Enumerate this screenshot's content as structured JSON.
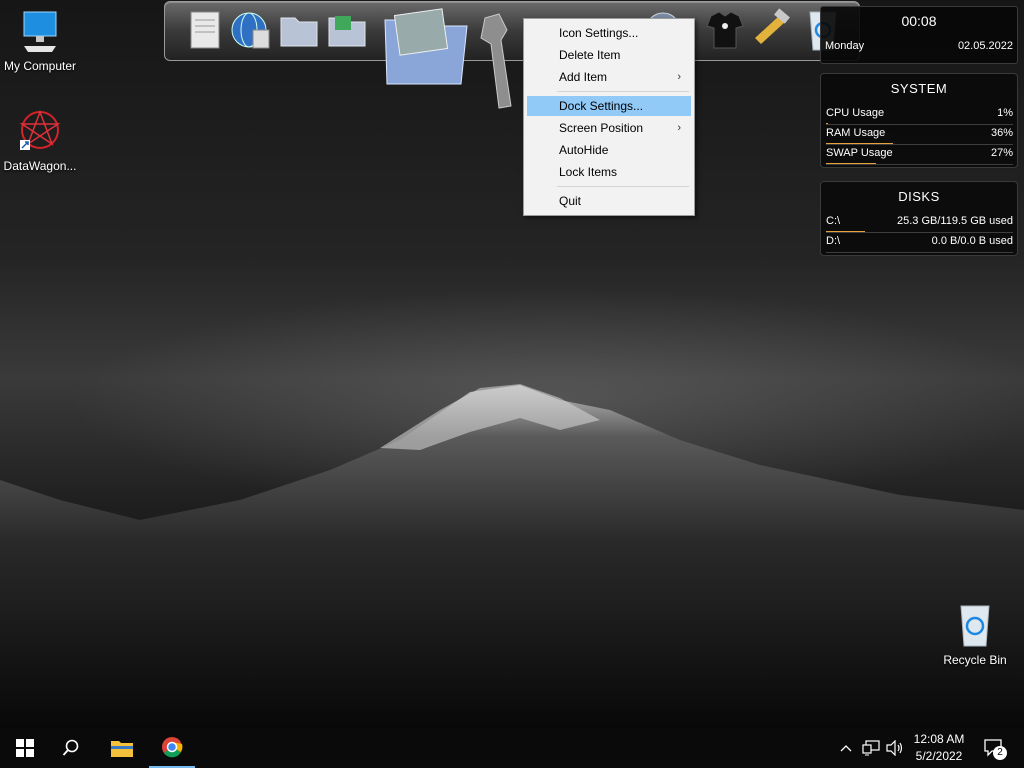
{
  "desktop": {
    "icons": [
      {
        "label": "My Computer",
        "icon": "monitor-icon"
      },
      {
        "label": "DataWagon...",
        "icon": "datawagon-shortcut-icon"
      },
      {
        "label": "Recycle Bin",
        "icon": "recycle-bin-icon"
      }
    ]
  },
  "dock": {
    "items": [
      "notepad-icon",
      "globe-browser-icon",
      "folder-icon",
      "green-folder-icon",
      "photo-folder-icon",
      "wrench-icon",
      "globe-icon",
      "tshirt-icon",
      "hammer-tools-icon",
      "recycle-bin-icon"
    ]
  },
  "context_menu": {
    "items": [
      {
        "label": "Icon Settings...",
        "submenu": false
      },
      {
        "label": "Delete Item",
        "submenu": false
      },
      {
        "label": "Add Item",
        "submenu": true
      },
      {
        "label": "Dock Settings...",
        "submenu": false,
        "highlighted": true
      },
      {
        "label": "Screen Position",
        "submenu": true
      },
      {
        "label": "AutoHide",
        "submenu": false
      },
      {
        "label": "Lock Items",
        "submenu": false
      },
      {
        "label": "Quit",
        "submenu": false
      }
    ],
    "arrow": "›"
  },
  "clock_widget": {
    "time": "00:08",
    "day": "Monday",
    "date": "02.05.2022"
  },
  "system_widget": {
    "title": "SYSTEM",
    "rows": [
      {
        "label": "CPU Usage",
        "value": "1%",
        "fraction": 0.01
      },
      {
        "label": "RAM Usage",
        "value": "36%",
        "fraction": 0.36
      },
      {
        "label": "SWAP Usage",
        "value": "27%",
        "fraction": 0.27
      }
    ]
  },
  "disks_widget": {
    "title": "DISKS",
    "rows": [
      {
        "label": "C:\\",
        "value": "25.3 GB/119.5 GB used",
        "fraction": 0.21
      },
      {
        "label": "D:\\",
        "value": "0.0 B/0.0 B used",
        "fraction": 0
      }
    ]
  },
  "taskbar": {
    "time": "12:08 AM",
    "date": "5/2/2022",
    "notification_count": "2"
  },
  "colors": {
    "accent_bar": "#e7a13d",
    "menu_highlight": "#91c9f7"
  }
}
